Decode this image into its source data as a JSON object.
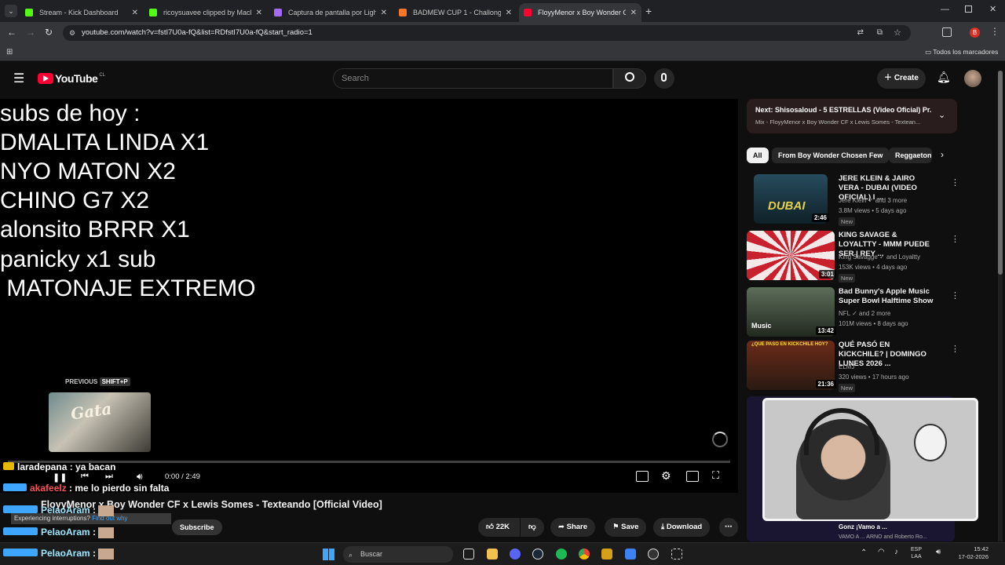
{
  "tabs": [
    {
      "title": "Stream - Kick Dashboard",
      "color": "#53fc18"
    },
    {
      "title": "ricoysuavee clipped by Machen",
      "color": "#53fc18"
    },
    {
      "title": "Captura de pantalla por Lightsh",
      "color": "#a56cf2"
    },
    {
      "title": "BADMEW CUP 1 - Challonge",
      "color": "#ff7324"
    },
    {
      "title": "FloyyMenor x Boy Wonder CF x",
      "color": "#ff0033"
    }
  ],
  "address": "youtube.com/watch?v=fstI7U0a-fQ&list=RDfstI7U0a-fQ&start_radio=1",
  "bookmarks_label": "Todos los marcadores",
  "yt": {
    "brand": "YouTube",
    "region": "CL",
    "search_placeholder": "Search",
    "create": "Create"
  },
  "video_overlay": [
    "subs de hoy :",
    "DMALITA LINDA X1",
    "NYO MATON X2",
    "CHINO G7 X2",
    "alonsito BRRR X1",
    "panicky x1 sub",
    " MATONAJE EXTREMO"
  ],
  "player": {
    "previous_label": "PREVIOUS",
    "previous_shortcut": "SHIFT+P",
    "previous_thumb_text": "Gata",
    "time": "0:00 / 2:49",
    "progress": 0.0
  },
  "video_title": "FloyyMenor x Boy Wonder CF x Lewis Somes - Texteando [Official Video]",
  "interruptions": "Experiencing interruptions?",
  "find_out": "Find out why",
  "subscribe": "Subscribe",
  "chat": [
    {
      "user": "laradepana",
      "msg": ": ya bacan",
      "color": "#ffffff"
    },
    {
      "user": "akafeelz",
      "msg": ": me lo pierdo sin falta",
      "color": "#ff5252"
    },
    {
      "user": "PelaoAram",
      "msg": ":",
      "color": "#9ee7ff"
    },
    {
      "user": "PelaoAram",
      "msg": ":",
      "color": "#9ee7ff"
    },
    {
      "user": "PelaoAram",
      "msg": ":",
      "color": "#9ee7ff"
    }
  ],
  "next": {
    "label": "Next:",
    "title": "Shisosaloud - 5 ESTRELLAS (Video Oficial) Pr...",
    "subtitle": "Mix - FloyyMenor x Boy Wonder CF x Lewis Somes - Textean..."
  },
  "chips": [
    "All",
    "From Boy Wonder Chosen Few",
    "Reggaeton"
  ],
  "recommendations": [
    {
      "title": "JERE KLEIN & JAIRO VERA - DUBAI (VIDEO OFICIAL) I ...",
      "channel": "Jere Klein",
      "channel_extra": "and 3 more",
      "meta": "3.8M views • 5 days ago",
      "badge": "New",
      "duration": "2:46",
      "thumb_text": "DUBAI",
      "thumb_color": "#1b3a4a"
    },
    {
      "title": "KING SAVAGE & LOYALTTY - MMM PUEDE SER | REY ...",
      "channel": "King Savagge",
      "channel_extra": "and Loyaltty",
      "meta": "153K views • 4 days ago",
      "badge": "New",
      "duration": "3:01",
      "thumb_text": "",
      "thumb_color": "#b5202a"
    },
    {
      "title": "Bad Bunny's Apple Music Super Bowl Halftime Show",
      "channel": "NFL",
      "channel_extra": "and 2 more",
      "meta": "101M views • 8 days ago",
      "badge": "",
      "duration": "13:42",
      "thumb_text": "Music",
      "thumb_color": "#3a4a3a"
    },
    {
      "title": "QUÉ PASÓ EN KICKCHILE? | DOMINGO LUNES 2026 ...",
      "channel": "ELMJ",
      "channel_extra": "",
      "meta": "320 views • 17 hours ago",
      "badge": "New",
      "duration": "21:36",
      "thumb_text": "¿QUE PASO EN KICKCHILE HOY?",
      "thumb_color": "#5a2a1a"
    }
  ],
  "partial_rec": {
    "channel": "Gonz",
    "title": "¡Vamo a ...",
    "meta": "VAMO A ... ARNO",
    "extra": "and Roberto Ro..."
  },
  "actions": {
    "likes": "22K",
    "share": "Share",
    "save": "Save",
    "download": "Download"
  },
  "taskbar": {
    "search": "Buscar",
    "lang1": "ESP",
    "lang2": "LAA",
    "time": "15:42",
    "date": "17-02-2026"
  },
  "colors": {
    "yt_red": "#ff0033",
    "accent": "#3ea6ff"
  }
}
